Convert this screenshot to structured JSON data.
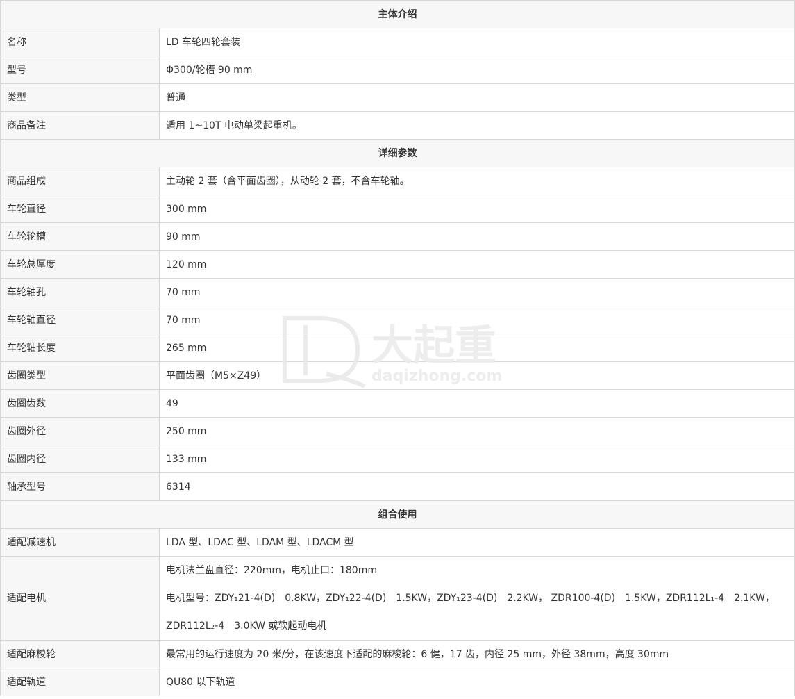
{
  "sections": [
    {
      "title": "主体介绍",
      "rows": [
        {
          "label": "名称",
          "value": "LD 车轮四轮套装"
        },
        {
          "label": "型号",
          "value": "Φ300/轮槽 90 mm"
        },
        {
          "label": "类型",
          "value": "普通"
        },
        {
          "label": "商品备注",
          "value": "适用 1~10T 电动单梁起重机。"
        }
      ]
    },
    {
      "title": "详细参数",
      "rows": [
        {
          "label": "商品组成",
          "value": "主动轮 2 套（含平面齿圈），从动轮 2 套，不含车轮轴。"
        },
        {
          "label": "车轮直径",
          "value": "300 mm"
        },
        {
          "label": "车轮轮槽",
          "value": "90 mm"
        },
        {
          "label": "车轮总厚度",
          "value": "120 mm"
        },
        {
          "label": "车轮轴孔",
          "value": "70 mm"
        },
        {
          "label": "车轮轴直径",
          "value": "70 mm"
        },
        {
          "label": "车轮轴长度",
          "value": "265 mm"
        },
        {
          "label": "齿圈类型",
          "value": "平面齿圈（M5×Z49）"
        },
        {
          "label": "齿圈齿数",
          "value": "49"
        },
        {
          "label": "齿圈外径",
          "value": "250 mm"
        },
        {
          "label": "齿圈内径",
          "value": "133 mm"
        },
        {
          "label": "轴承型号",
          "value": "6314"
        }
      ]
    },
    {
      "title": "组合使用",
      "rows": [
        {
          "label": "适配减速机",
          "value": "LDA 型、LDAC 型、LDAM 型、LDACM 型"
        },
        {
          "label": "适配电机",
          "lines": [
            "电机法兰盘直径：220mm，电机止口：180mm",
            "电机型号：ZDY₁21-4(D)　0.8KW，ZDY₁22-4(D)　1.5KW，ZDY₁23-4(D)　2.2KW，  ZDR100-4(D)　1.5KW，ZDR112L₁-4　2.1KW，",
            "ZDR112L₂-4　3.0KW 或软起动电机"
          ]
        },
        {
          "label": "适配麻梭轮",
          "value": "最常用的运行速度为 20 米/分，在该速度下适配的麻梭轮：6 健，17 齿，内径 25 mm，外径 38mm，高度 30mm"
        },
        {
          "label": "适配轨道",
          "value": "QU80 以下轨道"
        }
      ]
    }
  ],
  "watermark": {
    "logo_text": "大起重",
    "url_text": "daqizhong.com"
  }
}
